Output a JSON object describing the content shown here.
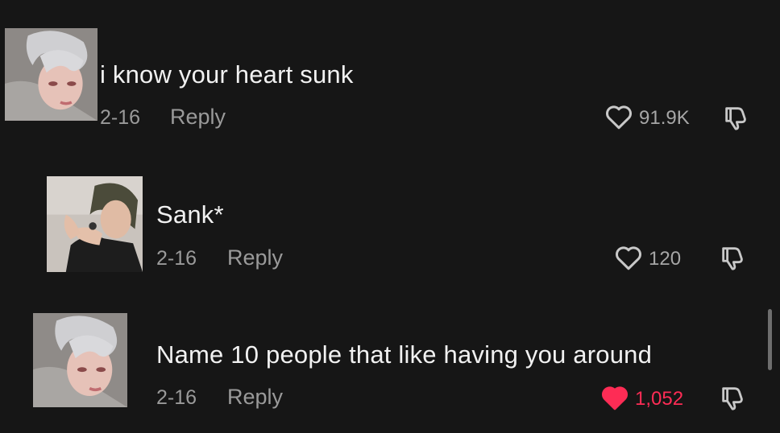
{
  "comments": [
    {
      "text": "i know your heart sunk",
      "date": "2-16",
      "reply_label": "Reply",
      "likes": "91.9K",
      "liked": false
    },
    {
      "text": "Sank*",
      "date": "2-16",
      "reply_label": "Reply",
      "likes": "120",
      "liked": false
    },
    {
      "text": "Name 10 people that like having you around",
      "date": "2-16",
      "reply_label": "Reply",
      "likes": "1,052",
      "liked": true
    }
  ],
  "colors": {
    "background": "#161616",
    "liked": "#fe2c55",
    "secondary_text": "#9a9a9a"
  },
  "icons": {
    "like": "heart-outline-icon",
    "liked": "heart-filled-icon",
    "dislike": "thumbs-down-icon"
  }
}
